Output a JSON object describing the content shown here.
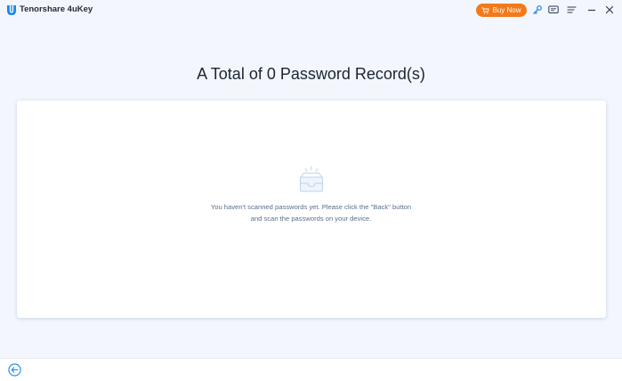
{
  "app": {
    "title": "Tenorshare 4uKey",
    "logo_icon": "tenorshare-u-logo"
  },
  "toolbar": {
    "buy_label": "Buy Now",
    "buy_icon": "cart-icon",
    "icons": [
      "key-icon",
      "feedback-icon",
      "menu-icon",
      "minimize-icon",
      "close-icon"
    ]
  },
  "main": {
    "heading": "A Total of 0 Password Record(s)",
    "empty_icon": "empty-box-icon",
    "empty_line1": "You haven't scanned passwords yet. Please click the \"Back\" button",
    "empty_line2": "and scan the passwords on your device."
  },
  "footer": {
    "back_icon": "back-arrow-icon"
  },
  "colors": {
    "accent": "#1a86e8",
    "buy_button": "#f27a1a",
    "background": "#f3f7fd",
    "card": "#ffffff",
    "heading_text": "#1b2432",
    "muted_text": "#5a6f8c"
  }
}
